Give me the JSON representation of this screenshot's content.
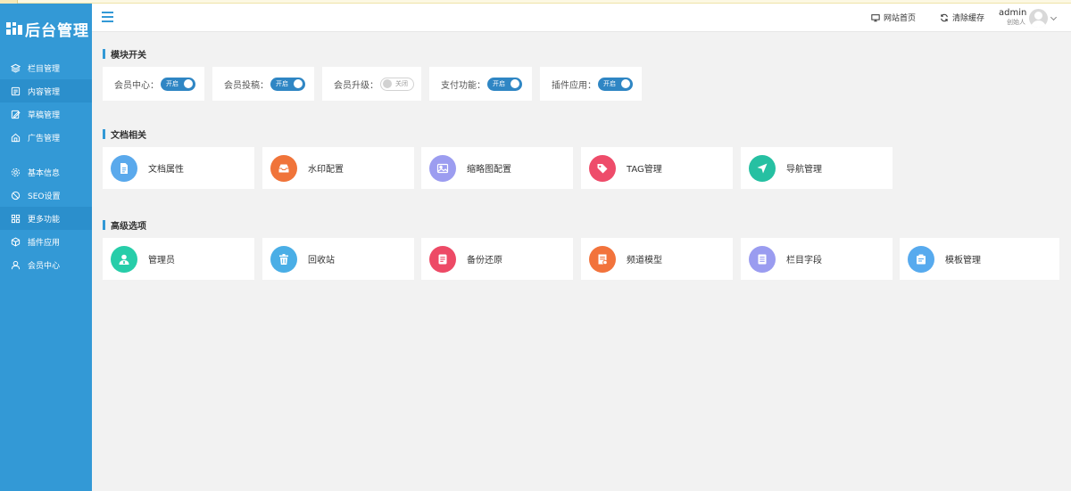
{
  "app": {
    "logo_text": "后台管理"
  },
  "sidebar": {
    "items": [
      {
        "label": "栏目管理",
        "icon": "layers-icon"
      },
      {
        "label": "内容管理",
        "icon": "document-icon"
      },
      {
        "label": "草稿管理",
        "icon": "edit-icon"
      },
      {
        "label": "广告管理",
        "icon": "home-icon"
      },
      {
        "label": "基本信息",
        "icon": "gear-icon"
      },
      {
        "label": "SEO设置",
        "icon": "ban-icon"
      },
      {
        "label": "更多功能",
        "icon": "grid-icon"
      },
      {
        "label": "插件应用",
        "icon": "cube-icon"
      },
      {
        "label": "会员中心",
        "icon": "user-icon"
      }
    ]
  },
  "header": {
    "home_link": "网站首页",
    "clear_cache": "清除缓存",
    "user_name": "admin",
    "user_role": "创始人"
  },
  "sections": {
    "switches_title": "模块开关",
    "docs_title": "文档相关",
    "advanced_title": "高级选项"
  },
  "switches": [
    {
      "label": "会员中心：",
      "state": "开启",
      "on": true
    },
    {
      "label": "会员投稿：",
      "state": "开启",
      "on": true
    },
    {
      "label": "会员升级：",
      "state": "关闭",
      "on": false
    },
    {
      "label": "支付功能：",
      "state": "开启",
      "on": true
    },
    {
      "label": "插件应用：",
      "state": "开启",
      "on": true
    }
  ],
  "docs": [
    {
      "label": "文档属性",
      "color": "#5aa9ec",
      "icon": "file-icon"
    },
    {
      "label": "水印配置",
      "color": "#f0743a",
      "icon": "inbox-icon"
    },
    {
      "label": "缩略图配置",
      "color": "#9c9df0",
      "icon": "image-icon"
    },
    {
      "label": "TAG管理",
      "color": "#ee4c6a",
      "icon": "tag-icon"
    },
    {
      "label": "导航管理",
      "color": "#26c0a2",
      "icon": "navigation-icon"
    }
  ],
  "advanced": [
    {
      "label": "管理员",
      "color": "#27cda9",
      "icon": "admin-icon"
    },
    {
      "label": "回收站",
      "color": "#4aaee6",
      "icon": "trash-icon"
    },
    {
      "label": "备份还原",
      "color": "#ed4a66",
      "icon": "backup-icon"
    },
    {
      "label": "频道模型",
      "color": "#f2733c",
      "icon": "model-icon"
    },
    {
      "label": "栏目字段",
      "color": "#9a9cf0",
      "icon": "list-icon"
    },
    {
      "label": "模板管理",
      "color": "#57aaee",
      "icon": "template-icon"
    }
  ],
  "colors": {
    "sidebar": "#3399d6",
    "accent": "#2f86c4",
    "background": "#f2f2f2"
  }
}
